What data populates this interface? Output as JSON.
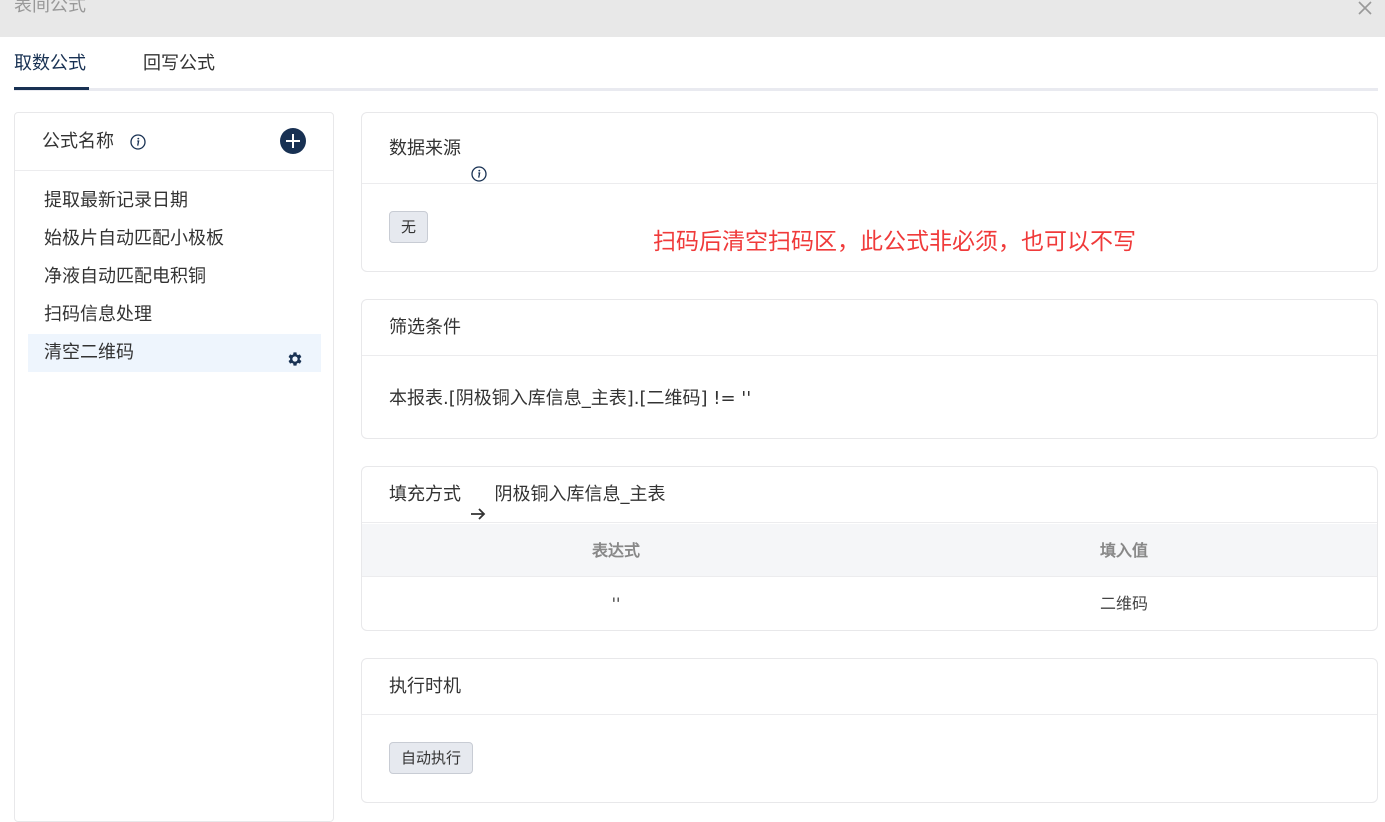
{
  "dialog": {
    "title": "表间公式"
  },
  "tabs": [
    {
      "label": "取数公式",
      "active": true
    },
    {
      "label": "回写公式",
      "active": false
    }
  ],
  "formula_list": {
    "header": "公式名称",
    "items": [
      {
        "label": "提取最新记录日期"
      },
      {
        "label": "始极片自动匹配小极板"
      },
      {
        "label": "净液自动匹配电积铜"
      },
      {
        "label": "扫码信息处理"
      },
      {
        "label": "清空二维码",
        "selected": true
      }
    ]
  },
  "data_source": {
    "title": "数据来源",
    "value": "无"
  },
  "annotation": "扫码后清空扫码区，此公式非必须，也可以不写",
  "filter": {
    "title": "筛选条件",
    "expression": "本报表.[阴极铜入库信息_主表].[二维码] != ''"
  },
  "fill": {
    "title": "填充方式",
    "target": "阴极铜入库信息_主表",
    "columns": [
      "表达式",
      "填入值"
    ],
    "rows": [
      [
        "''",
        "二维码"
      ]
    ]
  },
  "timing": {
    "title": "执行时机",
    "value": "自动执行"
  },
  "colors": {
    "accent": "#183153",
    "annotation": "#f03a3a",
    "selected_bg": "#eef5fd"
  }
}
